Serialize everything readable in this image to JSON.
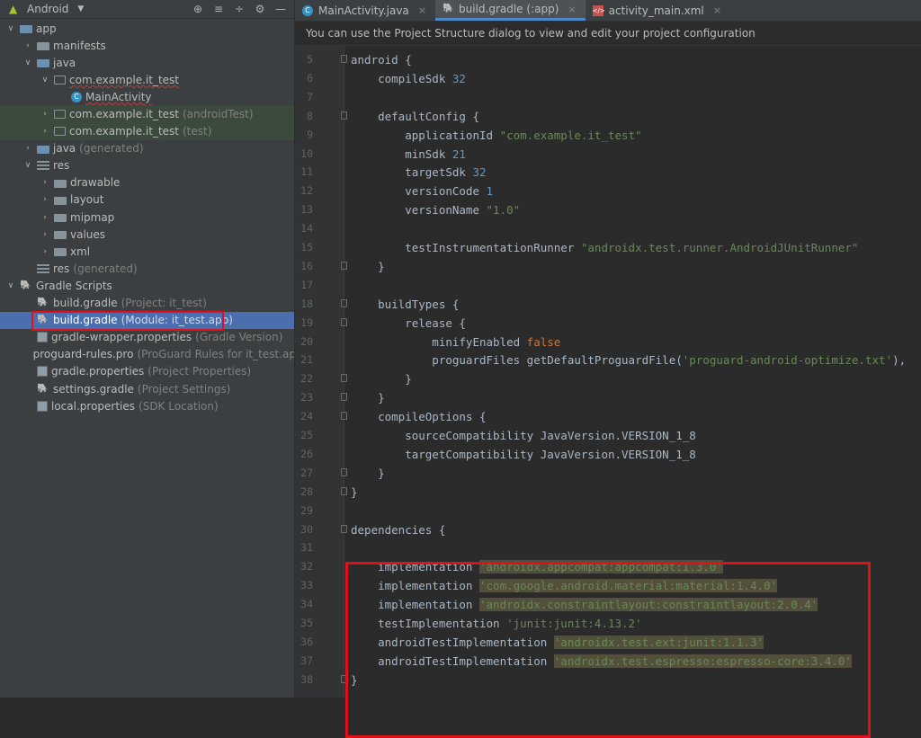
{
  "sidebar": {
    "view_name": "Android",
    "tools": [
      "target-icon",
      "collapse-all-icon",
      "expand-icon",
      "gear-icon",
      "minimize-icon"
    ],
    "tree": [
      {
        "label": "app",
        "hint": "",
        "icon": "app-module-icon",
        "chev": "down",
        "indent": 0
      },
      {
        "label": "manifests",
        "hint": "",
        "icon": "folder-icon",
        "chev": "right",
        "indent": 1
      },
      {
        "label": "java",
        "hint": "",
        "icon": "java-folder-icon",
        "chev": "down",
        "indent": 1
      },
      {
        "label": "com.example.it_test",
        "hint": "",
        "icon": "package-icon",
        "chev": "down",
        "indent": 2,
        "underline": true
      },
      {
        "label": "MainActivity",
        "hint": "",
        "icon": "class-icon",
        "chev": "none",
        "indent": 3,
        "underline": true
      },
      {
        "label": "com.example.it_test",
        "hint": "(androidTest)",
        "icon": "package-icon",
        "chev": "right",
        "indent": 2,
        "green": true
      },
      {
        "label": "com.example.it_test",
        "hint": "(test)",
        "icon": "package-icon",
        "chev": "right",
        "indent": 2,
        "green": true
      },
      {
        "label": "java",
        "hint": "(generated)",
        "icon": "java-folder-icon",
        "chev": "right",
        "indent": 1
      },
      {
        "label": "res",
        "hint": "",
        "icon": "res-folder-icon",
        "chev": "down",
        "indent": 1
      },
      {
        "label": "drawable",
        "hint": "",
        "icon": "folder-icon",
        "chev": "right",
        "indent": 2
      },
      {
        "label": "layout",
        "hint": "",
        "icon": "folder-icon",
        "chev": "right",
        "indent": 2
      },
      {
        "label": "mipmap",
        "hint": "",
        "icon": "folder-icon",
        "chev": "right",
        "indent": 2
      },
      {
        "label": "values",
        "hint": "",
        "icon": "folder-icon",
        "chev": "right",
        "indent": 2
      },
      {
        "label": "xml",
        "hint": "",
        "icon": "folder-icon",
        "chev": "right",
        "indent": 2
      },
      {
        "label": "res",
        "hint": "(generated)",
        "icon": "res-folder-icon",
        "chev": "none",
        "indent": 1
      },
      {
        "label": "Gradle Scripts",
        "hint": "",
        "icon": "gradle-icon",
        "chev": "down",
        "indent": 0
      },
      {
        "label": "build.gradle",
        "hint": "(Project: it_test)",
        "icon": "gradle-icon",
        "chev": "none",
        "indent": 1
      },
      {
        "label": "build.gradle",
        "hint": "(Module: it_test.app)",
        "icon": "gradle-icon",
        "chev": "none",
        "indent": 1,
        "selected": true
      },
      {
        "label": "gradle-wrapper.properties",
        "hint": "(Gradle Version)",
        "icon": "properties-icon",
        "chev": "none",
        "indent": 1
      },
      {
        "label": "proguard-rules.pro",
        "hint": "(ProGuard Rules for it_test.app)",
        "icon": "proguard-file-icon",
        "chev": "none",
        "indent": 1
      },
      {
        "label": "gradle.properties",
        "hint": "(Project Properties)",
        "icon": "properties-icon",
        "chev": "none",
        "indent": 1
      },
      {
        "label": "settings.gradle",
        "hint": "(Project Settings)",
        "icon": "gradle-icon",
        "chev": "none",
        "indent": 1
      },
      {
        "label": "local.properties",
        "hint": "(SDK Location)",
        "icon": "properties-icon",
        "chev": "none",
        "indent": 1
      }
    ]
  },
  "editor": {
    "tabs": [
      {
        "label": "MainActivity.java",
        "icon": "class-icon",
        "active": false
      },
      {
        "label": "build.gradle (:app)",
        "icon": "gradle-icon",
        "active": true
      },
      {
        "label": "activity_main.xml",
        "icon": "xml-file-icon",
        "active": false
      }
    ],
    "banner": "You can use the Project Structure dialog to view and edit your project configuration",
    "lines": [
      {
        "n": "5",
        "fold": true,
        "parts": [
          [
            "t",
            "android {"
          ]
        ]
      },
      {
        "n": "6",
        "parts": [
          [
            "t",
            "    compileSdk "
          ],
          [
            "num",
            "32"
          ]
        ]
      },
      {
        "n": "7",
        "parts": []
      },
      {
        "n": "8",
        "fold": true,
        "parts": [
          [
            "t",
            "    defaultConfig {"
          ]
        ]
      },
      {
        "n": "9",
        "parts": [
          [
            "t",
            "        applicationId "
          ],
          [
            "str",
            "\"com.example.it_test\""
          ]
        ]
      },
      {
        "n": "10",
        "parts": [
          [
            "t",
            "        minSdk "
          ],
          [
            "num",
            "21"
          ]
        ]
      },
      {
        "n": "11",
        "parts": [
          [
            "t",
            "        targetSdk "
          ],
          [
            "num",
            "32"
          ]
        ]
      },
      {
        "n": "12",
        "parts": [
          [
            "t",
            "        versionCode "
          ],
          [
            "num",
            "1"
          ]
        ]
      },
      {
        "n": "13",
        "parts": [
          [
            "t",
            "        versionName "
          ],
          [
            "str",
            "\"1.0\""
          ]
        ]
      },
      {
        "n": "14",
        "parts": []
      },
      {
        "n": "15",
        "parts": [
          [
            "t",
            "        testInstrumentationRunner "
          ],
          [
            "str",
            "\"androidx.test.runner.AndroidJUnitRunner\""
          ]
        ]
      },
      {
        "n": "16",
        "fold": true,
        "parts": [
          [
            "t",
            "    }"
          ]
        ]
      },
      {
        "n": "17",
        "parts": []
      },
      {
        "n": "18",
        "fold": true,
        "parts": [
          [
            "t",
            "    buildTypes {"
          ]
        ]
      },
      {
        "n": "19",
        "fold": true,
        "parts": [
          [
            "t",
            "        release {"
          ]
        ]
      },
      {
        "n": "20",
        "parts": [
          [
            "t",
            "            minifyEnabled "
          ],
          [
            "kw",
            "false"
          ]
        ]
      },
      {
        "n": "21",
        "parts": [
          [
            "t",
            "            proguardFiles getDefaultProguardFile("
          ],
          [
            "str",
            "'proguard-android-optimize.txt'"
          ],
          [
            "t",
            "),"
          ]
        ]
      },
      {
        "n": "22",
        "fold": true,
        "parts": [
          [
            "t",
            "        }"
          ]
        ]
      },
      {
        "n": "23",
        "fold": true,
        "parts": [
          [
            "t",
            "    }"
          ]
        ]
      },
      {
        "n": "24",
        "fold": true,
        "parts": [
          [
            "t",
            "    compileOptions {"
          ]
        ]
      },
      {
        "n": "25",
        "parts": [
          [
            "t",
            "        sourceCompatibility JavaVersion.VERSION_1_8"
          ]
        ]
      },
      {
        "n": "26",
        "parts": [
          [
            "t",
            "        targetCompatibility JavaVersion.VERSION_1_8"
          ]
        ]
      },
      {
        "n": "27",
        "fold": true,
        "parts": [
          [
            "t",
            "    }"
          ]
        ]
      },
      {
        "n": "28",
        "fold": true,
        "parts": [
          [
            "t",
            "}"
          ]
        ]
      },
      {
        "n": "29",
        "parts": []
      },
      {
        "n": "30",
        "fold": true,
        "parts": [
          [
            "t",
            "dependencies {"
          ]
        ]
      },
      {
        "n": "31",
        "parts": []
      },
      {
        "n": "32",
        "parts": [
          [
            "t",
            "    implementation "
          ],
          [
            "hl",
            "'androidx.appcompat:appcompat:1.3.0'"
          ]
        ]
      },
      {
        "n": "33",
        "parts": [
          [
            "t",
            "    implementation "
          ],
          [
            "hl",
            "'com.google.android.material:material:1.4.0'"
          ]
        ]
      },
      {
        "n": "34",
        "parts": [
          [
            "t",
            "    implementation "
          ],
          [
            "hl",
            "'androidx.constraintlayout:constraintlayout:2.0.4'"
          ]
        ]
      },
      {
        "n": "35",
        "parts": [
          [
            "t",
            "    testImplementation "
          ],
          [
            "str",
            "'junit:junit:4.13.2'"
          ]
        ]
      },
      {
        "n": "36",
        "parts": [
          [
            "t",
            "    androidTestImplementation "
          ],
          [
            "hl",
            "'androidx.test.ext:junit:1.1.3'"
          ]
        ]
      },
      {
        "n": "37",
        "parts": [
          [
            "t",
            "    androidTestImplementation "
          ],
          [
            "hl",
            "'androidx.test.espresso:espresso-core:3.4.0'"
          ]
        ]
      },
      {
        "n": "38",
        "fold": true,
        "parts": [
          [
            "t",
            "}"
          ]
        ]
      }
    ]
  },
  "colors": {
    "accent_red_box": "#e0111a",
    "selection": "#4b6eaf",
    "keyword": "#cc7832",
    "number": "#6897bb",
    "string": "#6a8759"
  }
}
